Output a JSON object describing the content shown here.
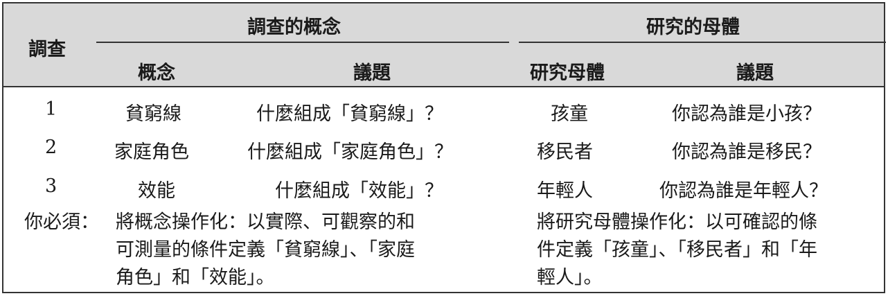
{
  "table": {
    "header": {
      "survey": "調查",
      "group_concept": "調查的概念",
      "group_population": "研究的母體",
      "col_concept": "概念",
      "col_issue1": "議題",
      "col_population": "研究母體",
      "col_issue2": "議題"
    },
    "rows": [
      {
        "num": "1",
        "concept": "貧窮線",
        "issue1": "什麼組成「貧窮線」？",
        "population": "孩童",
        "issue2": "你認為誰是小孩？"
      },
      {
        "num": "2",
        "concept": "家庭角色",
        "issue1": "什麼組成「家庭角色」？",
        "population": "移民者",
        "issue2": "你認為誰是移民？"
      },
      {
        "num": "3",
        "concept": "效能",
        "issue1": "什麼組成「效能」？",
        "population": "年輕人",
        "issue2": "你認為誰是年輕人？"
      }
    ],
    "footer": {
      "lead": "你必須：",
      "left_lines": [
        "將概念操作化：以實際、可觀察的和",
        "可測量的條件定義「貧窮線」、「家庭",
        "角色」和「效能」。"
      ],
      "right_lines": [
        "將研究母體操作化：以可確認的條",
        "件定義「孩童」、「移民者」和「年",
        "輕人」。"
      ]
    }
  }
}
